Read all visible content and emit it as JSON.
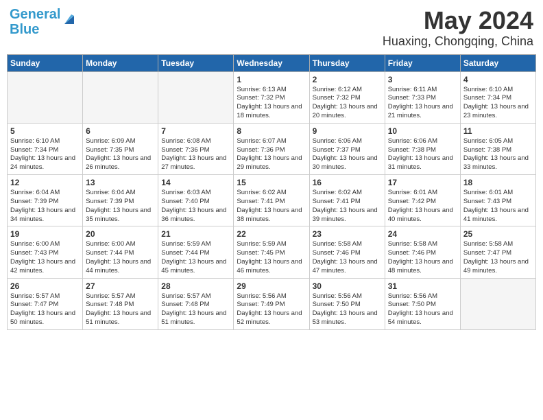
{
  "logo": {
    "part1": "General",
    "part2": "Blue"
  },
  "title": "May 2024",
  "subtitle": "Huaxing, Chongqing, China",
  "days_header": [
    "Sunday",
    "Monday",
    "Tuesday",
    "Wednesday",
    "Thursday",
    "Friday",
    "Saturday"
  ],
  "weeks": [
    {
      "cells": [
        {
          "day": "",
          "info": "",
          "empty": true
        },
        {
          "day": "",
          "info": "",
          "empty": true
        },
        {
          "day": "",
          "info": "",
          "empty": true
        },
        {
          "day": "1",
          "info": "Sunrise: 6:13 AM\nSunset: 7:32 PM\nDaylight: 13 hours and 18 minutes.",
          "empty": false
        },
        {
          "day": "2",
          "info": "Sunrise: 6:12 AM\nSunset: 7:32 PM\nDaylight: 13 hours and 20 minutes.",
          "empty": false
        },
        {
          "day": "3",
          "info": "Sunrise: 6:11 AM\nSunset: 7:33 PM\nDaylight: 13 hours and 21 minutes.",
          "empty": false
        },
        {
          "day": "4",
          "info": "Sunrise: 6:10 AM\nSunset: 7:34 PM\nDaylight: 13 hours and 23 minutes.",
          "empty": false
        }
      ]
    },
    {
      "cells": [
        {
          "day": "5",
          "info": "Sunrise: 6:10 AM\nSunset: 7:34 PM\nDaylight: 13 hours and 24 minutes.",
          "empty": false
        },
        {
          "day": "6",
          "info": "Sunrise: 6:09 AM\nSunset: 7:35 PM\nDaylight: 13 hours and 26 minutes.",
          "empty": false
        },
        {
          "day": "7",
          "info": "Sunrise: 6:08 AM\nSunset: 7:36 PM\nDaylight: 13 hours and 27 minutes.",
          "empty": false
        },
        {
          "day": "8",
          "info": "Sunrise: 6:07 AM\nSunset: 7:36 PM\nDaylight: 13 hours and 29 minutes.",
          "empty": false
        },
        {
          "day": "9",
          "info": "Sunrise: 6:06 AM\nSunset: 7:37 PM\nDaylight: 13 hours and 30 minutes.",
          "empty": false
        },
        {
          "day": "10",
          "info": "Sunrise: 6:06 AM\nSunset: 7:38 PM\nDaylight: 13 hours and 31 minutes.",
          "empty": false
        },
        {
          "day": "11",
          "info": "Sunrise: 6:05 AM\nSunset: 7:38 PM\nDaylight: 13 hours and 33 minutes.",
          "empty": false
        }
      ]
    },
    {
      "cells": [
        {
          "day": "12",
          "info": "Sunrise: 6:04 AM\nSunset: 7:39 PM\nDaylight: 13 hours and 34 minutes.",
          "empty": false
        },
        {
          "day": "13",
          "info": "Sunrise: 6:04 AM\nSunset: 7:39 PM\nDaylight: 13 hours and 35 minutes.",
          "empty": false
        },
        {
          "day": "14",
          "info": "Sunrise: 6:03 AM\nSunset: 7:40 PM\nDaylight: 13 hours and 36 minutes.",
          "empty": false
        },
        {
          "day": "15",
          "info": "Sunrise: 6:02 AM\nSunset: 7:41 PM\nDaylight: 13 hours and 38 minutes.",
          "empty": false
        },
        {
          "day": "16",
          "info": "Sunrise: 6:02 AM\nSunset: 7:41 PM\nDaylight: 13 hours and 39 minutes.",
          "empty": false
        },
        {
          "day": "17",
          "info": "Sunrise: 6:01 AM\nSunset: 7:42 PM\nDaylight: 13 hours and 40 minutes.",
          "empty": false
        },
        {
          "day": "18",
          "info": "Sunrise: 6:01 AM\nSunset: 7:43 PM\nDaylight: 13 hours and 41 minutes.",
          "empty": false
        }
      ]
    },
    {
      "cells": [
        {
          "day": "19",
          "info": "Sunrise: 6:00 AM\nSunset: 7:43 PM\nDaylight: 13 hours and 42 minutes.",
          "empty": false
        },
        {
          "day": "20",
          "info": "Sunrise: 6:00 AM\nSunset: 7:44 PM\nDaylight: 13 hours and 44 minutes.",
          "empty": false
        },
        {
          "day": "21",
          "info": "Sunrise: 5:59 AM\nSunset: 7:44 PM\nDaylight: 13 hours and 45 minutes.",
          "empty": false
        },
        {
          "day": "22",
          "info": "Sunrise: 5:59 AM\nSunset: 7:45 PM\nDaylight: 13 hours and 46 minutes.",
          "empty": false
        },
        {
          "day": "23",
          "info": "Sunrise: 5:58 AM\nSunset: 7:46 PM\nDaylight: 13 hours and 47 minutes.",
          "empty": false
        },
        {
          "day": "24",
          "info": "Sunrise: 5:58 AM\nSunset: 7:46 PM\nDaylight: 13 hours and 48 minutes.",
          "empty": false
        },
        {
          "day": "25",
          "info": "Sunrise: 5:58 AM\nSunset: 7:47 PM\nDaylight: 13 hours and 49 minutes.",
          "empty": false
        }
      ]
    },
    {
      "cells": [
        {
          "day": "26",
          "info": "Sunrise: 5:57 AM\nSunset: 7:47 PM\nDaylight: 13 hours and 50 minutes.",
          "empty": false
        },
        {
          "day": "27",
          "info": "Sunrise: 5:57 AM\nSunset: 7:48 PM\nDaylight: 13 hours and 51 minutes.",
          "empty": false
        },
        {
          "day": "28",
          "info": "Sunrise: 5:57 AM\nSunset: 7:48 PM\nDaylight: 13 hours and 51 minutes.",
          "empty": false
        },
        {
          "day": "29",
          "info": "Sunrise: 5:56 AM\nSunset: 7:49 PM\nDaylight: 13 hours and 52 minutes.",
          "empty": false
        },
        {
          "day": "30",
          "info": "Sunrise: 5:56 AM\nSunset: 7:50 PM\nDaylight: 13 hours and 53 minutes.",
          "empty": false
        },
        {
          "day": "31",
          "info": "Sunrise: 5:56 AM\nSunset: 7:50 PM\nDaylight: 13 hours and 54 minutes.",
          "empty": false
        },
        {
          "day": "",
          "info": "",
          "empty": true
        }
      ]
    }
  ]
}
